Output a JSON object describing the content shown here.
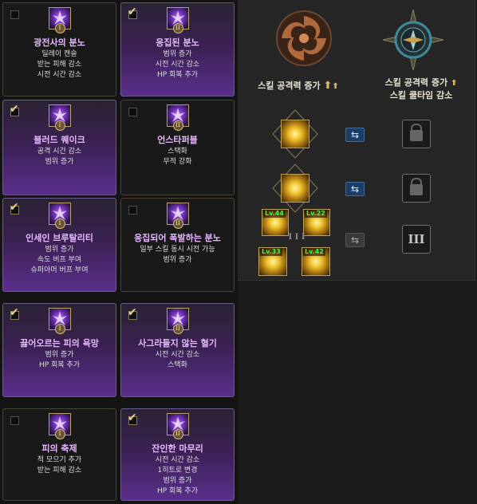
{
  "cards": [
    {
      "title": "광전사의 분노",
      "lines": [
        "딜레이 캔슬",
        "받는 피해 감소",
        "시전 시간 감소"
      ],
      "checked": false,
      "active": false,
      "rank": "I"
    },
    {
      "title": "응집된 분노",
      "lines": [
        "범위 증가",
        "시전 시간 감소",
        "HP 회복 추가"
      ],
      "checked": true,
      "active": true,
      "rank": "II"
    },
    {
      "title": "블러드 퀘이크",
      "lines": [
        "공격 시간 감소",
        "범위 증가"
      ],
      "checked": true,
      "active": true,
      "rank": "I"
    },
    {
      "title": "언스타퍼블",
      "lines": [
        "스택화",
        "무적 강화"
      ],
      "checked": false,
      "active": false,
      "rank": "II"
    },
    {
      "title": "인세인 브루탈리티",
      "lines": [
        "범위 증가",
        "속도 버프 부여",
        "슈퍼아머 버프 부여"
      ],
      "checked": true,
      "active": true,
      "rank": "I"
    },
    {
      "title": "응집되어 폭발하는 분노",
      "lines": [
        "일부 스킬 동시 시전 가능",
        "범위 증가"
      ],
      "checked": false,
      "active": false,
      "rank": "II"
    },
    {
      "title": "끓어오르는 피의 욕망",
      "lines": [
        "범위 증가",
        "HP 회복 추가"
      ],
      "checked": true,
      "active": true,
      "rank": "I"
    },
    {
      "title": "사그라들지 않는 혈기",
      "lines": [
        "시전 시간 감소",
        "스택화"
      ],
      "checked": true,
      "active": true,
      "rank": "II"
    },
    {
      "title": "피의 축제",
      "lines": [
        "적 모으기 추가",
        "받는 피해 감소"
      ],
      "checked": false,
      "active": false,
      "rank": "I"
    },
    {
      "title": "잔인한 마무리",
      "lines": [
        "시전 시간 감소",
        "1히트로 변경",
        "범위 증가",
        "HP 회복 추가"
      ],
      "checked": true,
      "active": true,
      "rank": "II"
    }
  ],
  "right_panel": {
    "heading_left": "스킬 공격력 증가",
    "heading_right_1": "스킬 공격력 증가",
    "heading_right_2": "스킬 쿨타임 감소",
    "arrow": "⬆",
    "swap_glyph": "⇆",
    "roman_three": "III",
    "skill_levels": [
      "Lv.44",
      "Lv.22",
      "Lv.33",
      "Lv.42"
    ],
    "small_roman": "I I I"
  }
}
